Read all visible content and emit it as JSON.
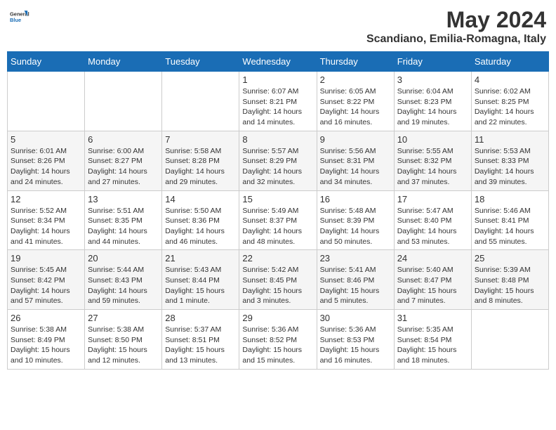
{
  "logo": {
    "text_general": "General",
    "text_blue": "Blue"
  },
  "header": {
    "title": "May 2024",
    "subtitle": "Scandiano, Emilia-Romagna, Italy"
  },
  "weekdays": [
    "Sunday",
    "Monday",
    "Tuesday",
    "Wednesday",
    "Thursday",
    "Friday",
    "Saturday"
  ],
  "weeks": [
    [
      {
        "day": "",
        "info": ""
      },
      {
        "day": "",
        "info": ""
      },
      {
        "day": "",
        "info": ""
      },
      {
        "day": "1",
        "info": "Sunrise: 6:07 AM\nSunset: 8:21 PM\nDaylight: 14 hours and 14 minutes."
      },
      {
        "day": "2",
        "info": "Sunrise: 6:05 AM\nSunset: 8:22 PM\nDaylight: 14 hours and 16 minutes."
      },
      {
        "day": "3",
        "info": "Sunrise: 6:04 AM\nSunset: 8:23 PM\nDaylight: 14 hours and 19 minutes."
      },
      {
        "day": "4",
        "info": "Sunrise: 6:02 AM\nSunset: 8:25 PM\nDaylight: 14 hours and 22 minutes."
      }
    ],
    [
      {
        "day": "5",
        "info": "Sunrise: 6:01 AM\nSunset: 8:26 PM\nDaylight: 14 hours and 24 minutes."
      },
      {
        "day": "6",
        "info": "Sunrise: 6:00 AM\nSunset: 8:27 PM\nDaylight: 14 hours and 27 minutes."
      },
      {
        "day": "7",
        "info": "Sunrise: 5:58 AM\nSunset: 8:28 PM\nDaylight: 14 hours and 29 minutes."
      },
      {
        "day": "8",
        "info": "Sunrise: 5:57 AM\nSunset: 8:29 PM\nDaylight: 14 hours and 32 minutes."
      },
      {
        "day": "9",
        "info": "Sunrise: 5:56 AM\nSunset: 8:31 PM\nDaylight: 14 hours and 34 minutes."
      },
      {
        "day": "10",
        "info": "Sunrise: 5:55 AM\nSunset: 8:32 PM\nDaylight: 14 hours and 37 minutes."
      },
      {
        "day": "11",
        "info": "Sunrise: 5:53 AM\nSunset: 8:33 PM\nDaylight: 14 hours and 39 minutes."
      }
    ],
    [
      {
        "day": "12",
        "info": "Sunrise: 5:52 AM\nSunset: 8:34 PM\nDaylight: 14 hours and 41 minutes."
      },
      {
        "day": "13",
        "info": "Sunrise: 5:51 AM\nSunset: 8:35 PM\nDaylight: 14 hours and 44 minutes."
      },
      {
        "day": "14",
        "info": "Sunrise: 5:50 AM\nSunset: 8:36 PM\nDaylight: 14 hours and 46 minutes."
      },
      {
        "day": "15",
        "info": "Sunrise: 5:49 AM\nSunset: 8:37 PM\nDaylight: 14 hours and 48 minutes."
      },
      {
        "day": "16",
        "info": "Sunrise: 5:48 AM\nSunset: 8:39 PM\nDaylight: 14 hours and 50 minutes."
      },
      {
        "day": "17",
        "info": "Sunrise: 5:47 AM\nSunset: 8:40 PM\nDaylight: 14 hours and 53 minutes."
      },
      {
        "day": "18",
        "info": "Sunrise: 5:46 AM\nSunset: 8:41 PM\nDaylight: 14 hours and 55 minutes."
      }
    ],
    [
      {
        "day": "19",
        "info": "Sunrise: 5:45 AM\nSunset: 8:42 PM\nDaylight: 14 hours and 57 minutes."
      },
      {
        "day": "20",
        "info": "Sunrise: 5:44 AM\nSunset: 8:43 PM\nDaylight: 14 hours and 59 minutes."
      },
      {
        "day": "21",
        "info": "Sunrise: 5:43 AM\nSunset: 8:44 PM\nDaylight: 15 hours and 1 minute."
      },
      {
        "day": "22",
        "info": "Sunrise: 5:42 AM\nSunset: 8:45 PM\nDaylight: 15 hours and 3 minutes."
      },
      {
        "day": "23",
        "info": "Sunrise: 5:41 AM\nSunset: 8:46 PM\nDaylight: 15 hours and 5 minutes."
      },
      {
        "day": "24",
        "info": "Sunrise: 5:40 AM\nSunset: 8:47 PM\nDaylight: 15 hours and 7 minutes."
      },
      {
        "day": "25",
        "info": "Sunrise: 5:39 AM\nSunset: 8:48 PM\nDaylight: 15 hours and 8 minutes."
      }
    ],
    [
      {
        "day": "26",
        "info": "Sunrise: 5:38 AM\nSunset: 8:49 PM\nDaylight: 15 hours and 10 minutes."
      },
      {
        "day": "27",
        "info": "Sunrise: 5:38 AM\nSunset: 8:50 PM\nDaylight: 15 hours and 12 minutes."
      },
      {
        "day": "28",
        "info": "Sunrise: 5:37 AM\nSunset: 8:51 PM\nDaylight: 15 hours and 13 minutes."
      },
      {
        "day": "29",
        "info": "Sunrise: 5:36 AM\nSunset: 8:52 PM\nDaylight: 15 hours and 15 minutes."
      },
      {
        "day": "30",
        "info": "Sunrise: 5:36 AM\nSunset: 8:53 PM\nDaylight: 15 hours and 16 minutes."
      },
      {
        "day": "31",
        "info": "Sunrise: 5:35 AM\nSunset: 8:54 PM\nDaylight: 15 hours and 18 minutes."
      },
      {
        "day": "",
        "info": ""
      }
    ]
  ]
}
